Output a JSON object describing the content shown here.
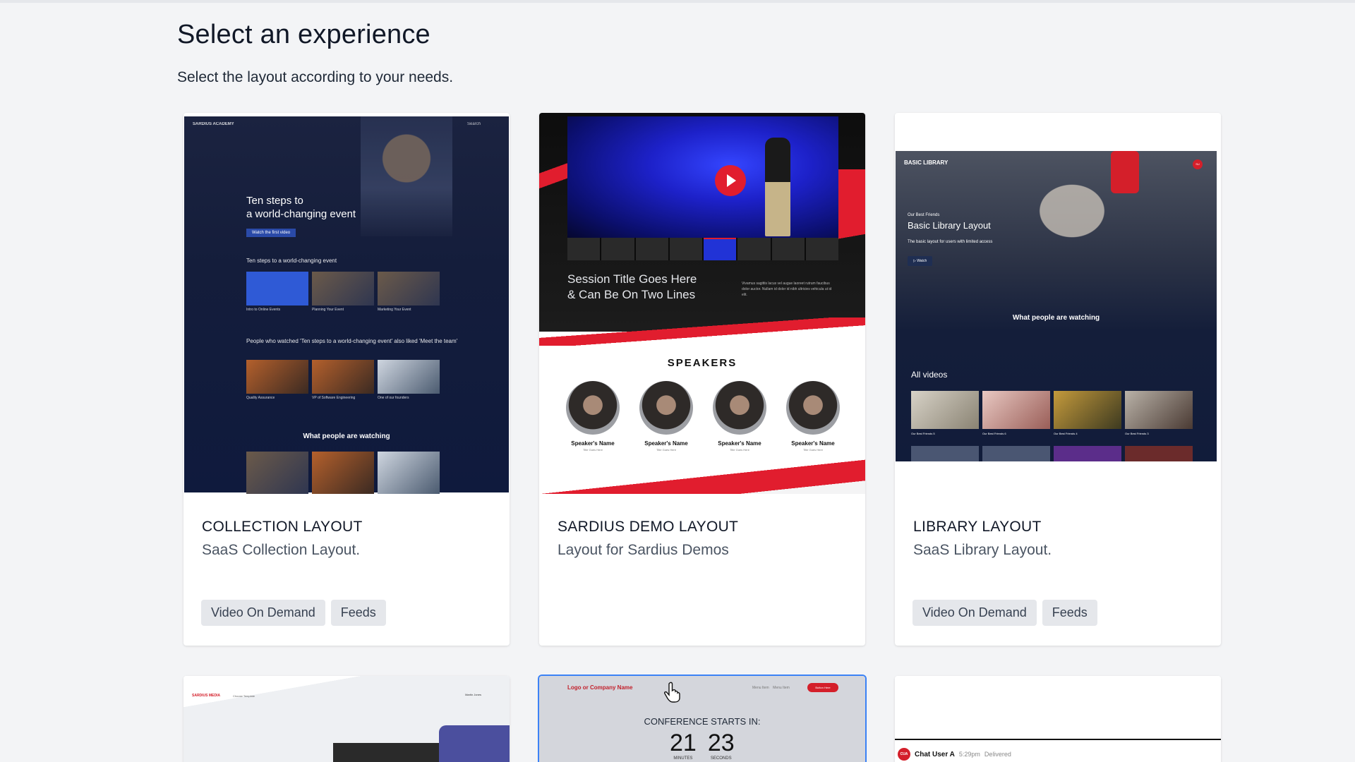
{
  "page": {
    "title": "Select an experience",
    "subtitle": "Select the layout according to your needs."
  },
  "cards": [
    {
      "name": "COLLECTION LAYOUT",
      "description": "SaaS Collection Layout.",
      "tags": [
        "Video On Demand",
        "Feeds"
      ],
      "preview": {
        "brand": "SARDIUS ACADEMY",
        "search": "Search",
        "hero": "Ten steps to\na world-changing event",
        "cta": "Watch the first video",
        "section1": "Ten steps to a world-changing event",
        "row1": [
          "Intro to Online Events",
          "Planning Your Event",
          "Marketing Your Event"
        ],
        "section2": "People who watched 'Ten steps to a world-changing event' also liked 'Meet the team'",
        "row2": [
          "Quality Assurance",
          "VP of Software Engineering",
          "One of our founders"
        ],
        "section3": "What people are watching"
      }
    },
    {
      "name": "SARDIUS DEMO LAYOUT",
      "description": "Layout for Sardius Demos",
      "tags": [],
      "preview": {
        "session": "Session Title Goes Here\n& Can Be On Two Lines",
        "lorem": "Vivamus sagittis lacus vel augue laoreet rutrum faucibus dolor auctor. Nullam id dolor id nibh ultricies vehicula ut id elit.",
        "speakers_title": "SPEAKERS",
        "speakers": [
          {
            "name": "Speaker's Name",
            "title": "Title Goes Here"
          },
          {
            "name": "Speaker's Name",
            "title": "Title Goes Here"
          },
          {
            "name": "Speaker's Name",
            "title": "Title Goes Here"
          },
          {
            "name": "Speaker's Name",
            "title": "Title Goes Here"
          }
        ]
      }
    },
    {
      "name": "LIBRARY LAYOUT",
      "description": "SaaS Library Layout.",
      "tags": [
        "Video On Demand",
        "Feeds"
      ],
      "preview": {
        "brand": "BASIC LIBRARY",
        "avatar": "SU",
        "eyebrow": "Our Best Friends",
        "hero": "Basic Library Layout",
        "desc": "The basic layout for users with limited access",
        "watch": "▷ Watch",
        "watching": "What people are watching",
        "all_videos": "All videos",
        "tiles": [
          "Our Best Friends 5",
          "Our Best Friends 6",
          "Our Best Friends 4",
          "Our Best Friends 3"
        ]
      }
    }
  ],
  "row2": {
    "a": {
      "logo": "SARDIUS MEDIA",
      "template": "Choose Template",
      "user": "Martin Jones"
    },
    "b": {
      "logo": "Logo or Company Name",
      "menu": "Menu Item    Menu Item",
      "button": "Button Here",
      "countdown_label": "CONFERENCE STARTS IN:",
      "minutes": "21",
      "minutes_label": "MINUTES",
      "seconds": "23",
      "seconds_label": "SECONDS"
    },
    "c": {
      "avatar": "CUA",
      "user": "Chat User A",
      "time": "5:29pm",
      "status": "Delivered"
    }
  },
  "colors": {
    "accent_red": "#e11d2e",
    "tag_bg": "#e5e7eb",
    "selected_border": "#3b82f6"
  }
}
